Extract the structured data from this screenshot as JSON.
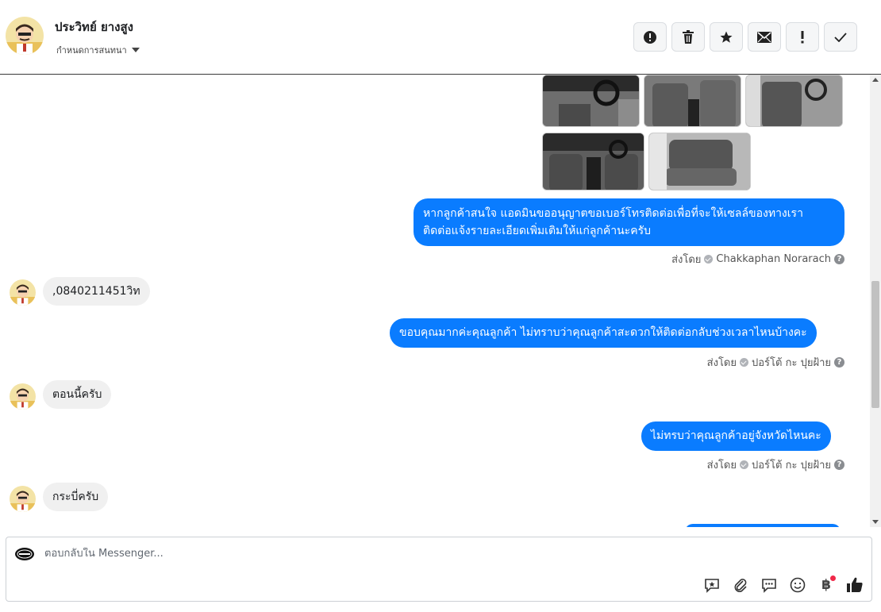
{
  "header": {
    "name": "ประวิทย์ ยางสูง",
    "assign_label": "กำหนดการสนทนา"
  },
  "toolbar": [
    {
      "name": "spam-button",
      "icon": "alert-circle-icon"
    },
    {
      "name": "delete-button",
      "icon": "trash-icon"
    },
    {
      "name": "star-button",
      "icon": "star-icon"
    },
    {
      "name": "mark-unread-button",
      "icon": "envelope-icon"
    },
    {
      "name": "follow-up-button",
      "icon": "exclamation-icon"
    },
    {
      "name": "mark-done-button",
      "icon": "check-icon"
    }
  ],
  "messages": {
    "m1": "หากลูกค้าสนใจ แอดมินขออนุญาตขอเบอร์โทรติดต่อเพื่อที่จะให้เซลล์ของทางเรา",
    "m1b": "ติดต่อแจ้งรายละเอียดเพิ่มเติมให้แก่ลูกค้านะครับ",
    "m1_sender_prefix": "ส่งโดย",
    "m1_sender": "Chakkaphan Norarach",
    "m2": ",0840211451วิท",
    "m3": "ขอบคุณมากค่ะคุณลูกค้า ไม่ทราบว่าคุณลูกค้าสะดวกให้ติดต่อกลับช่วงเวลาไหนบ้างคะ",
    "m3_sender_prefix": "ส่งโดย",
    "m3_sender": "ปอร์โต้ กะ ปุยฝ้าย",
    "m4": "ตอนนี้ครับ",
    "m5": "ไม่ทรบว่าคุณลูกค้าอยู่จังหวัดไหนคะ",
    "m5_sender_prefix": "ส่งโดย",
    "m5_sender": "ปอร์โต้ กะ ปุยฝ้าย",
    "m6": "กระบี่ครับ",
    "help": "?"
  },
  "reply": {
    "placeholder": "ตอบกลับใน Messenger...",
    "baht": "฿"
  },
  "colors": {
    "outgoing_bubble": "#0a7cff",
    "incoming_bubble": "#f0f0f0",
    "notification_dot": "#f02849"
  }
}
